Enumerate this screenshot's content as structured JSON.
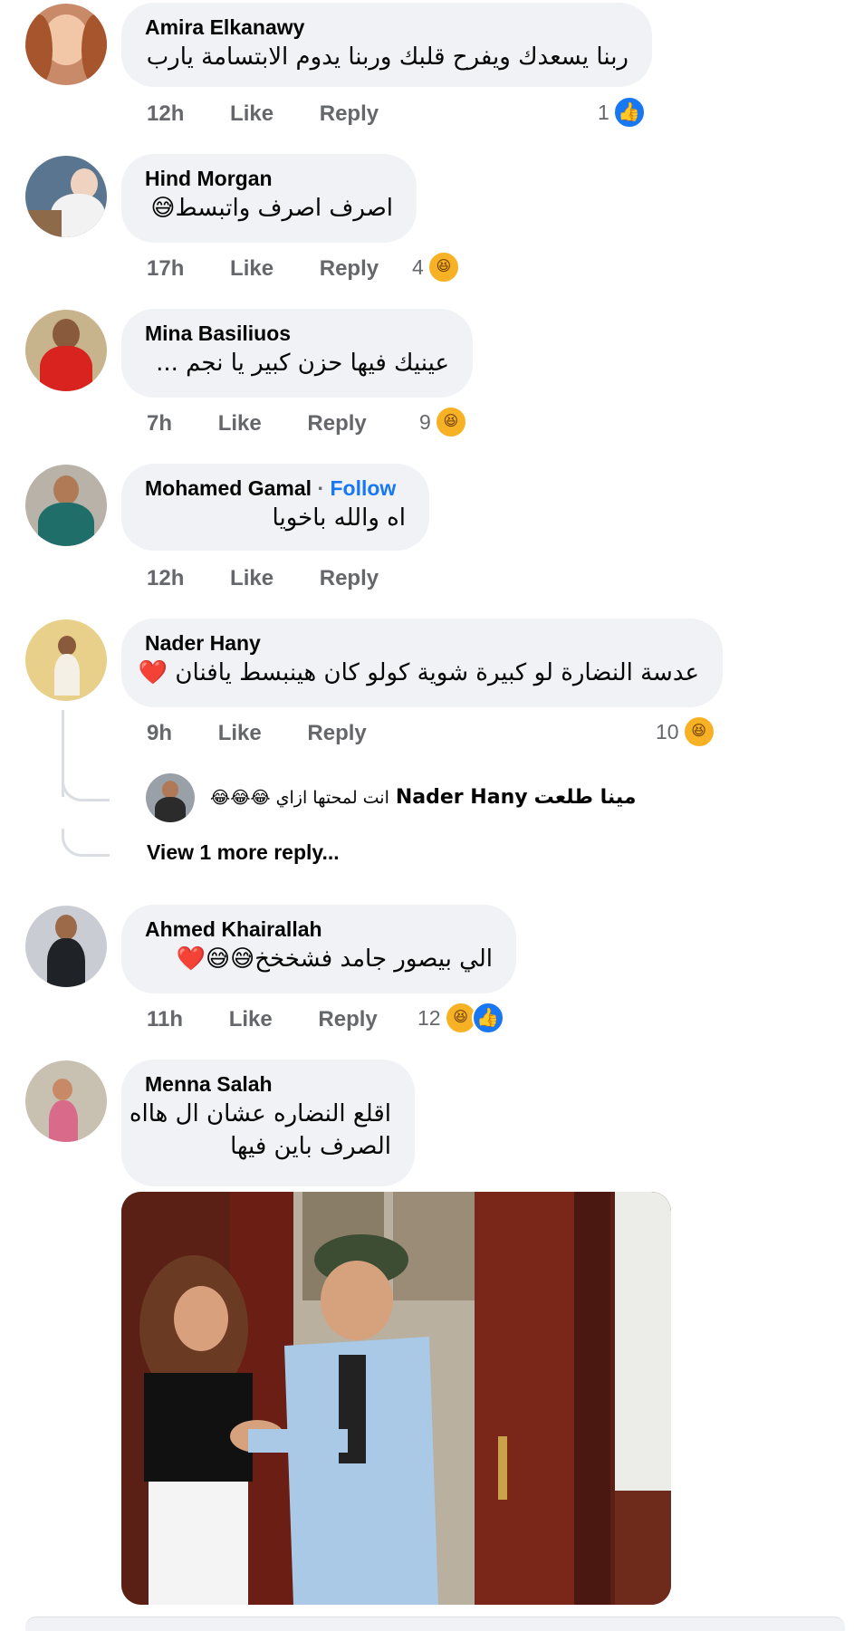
{
  "comments": [
    {
      "author": "Amira Elkanawy",
      "text": "ربنا يسعدك ويفرح قلبك وربنا يدوم الابتسامة يارب",
      "time": "12h",
      "like": "Like",
      "reply": "Reply",
      "reaction_count": "1",
      "reaction_icons": [
        "like-icon"
      ]
    },
    {
      "author": "Hind Morgan",
      "text": "اصرف اصرف واتبسط😅",
      "time": "17h",
      "like": "Like",
      "reply": "Reply",
      "reaction_count": "4",
      "reaction_icons": [
        "haha-icon"
      ]
    },
    {
      "author": "Mina Basiliuos",
      "text": "عينيك فيها حزن كبير يا نجم ...",
      "time": "7h",
      "like": "Like",
      "reply": "Reply",
      "reaction_count": "9",
      "reaction_icons": [
        "haha-icon"
      ]
    },
    {
      "author": "Mohamed Gamal",
      "follow": "Follow",
      "separator": "·",
      "text": "اه والله باخويا",
      "time": "12h",
      "like": "Like",
      "reply": "Reply"
    },
    {
      "author": "Nader Hany",
      "text": "عدسة النضارة لو كبيرة شوية كولو كان هينبسط يافنان ❤️",
      "time": "9h",
      "like": "Like",
      "reply": "Reply",
      "reaction_count": "10",
      "reaction_icons": [
        "haha-icon"
      ],
      "reply_preview": {
        "author": "مينا طلعت",
        "mention": "Nader Hany",
        "text": "انت لمحتها ازاي 😂😂😂"
      },
      "view_more": "View 1 more reply..."
    },
    {
      "author": "Ahmed Khairallah",
      "text": "الي بيصور جامد فشخخخ😅😅❤️",
      "time": "11h",
      "like": "Like",
      "reply": "Reply",
      "reaction_count": "12",
      "reaction_icons": [
        "haha-icon",
        "like-icon"
      ]
    },
    {
      "author": "Menna Salah",
      "text_line1": "اقلع النضاره عشان ال هااه",
      "text_line2": "الصرف باين فيها",
      "has_gif": true
    }
  ],
  "colors": {
    "bubble": "#f0f2f5",
    "meta_text": "#65676b",
    "link_blue": "#1877f2",
    "haha_yellow": "#f7b125"
  }
}
